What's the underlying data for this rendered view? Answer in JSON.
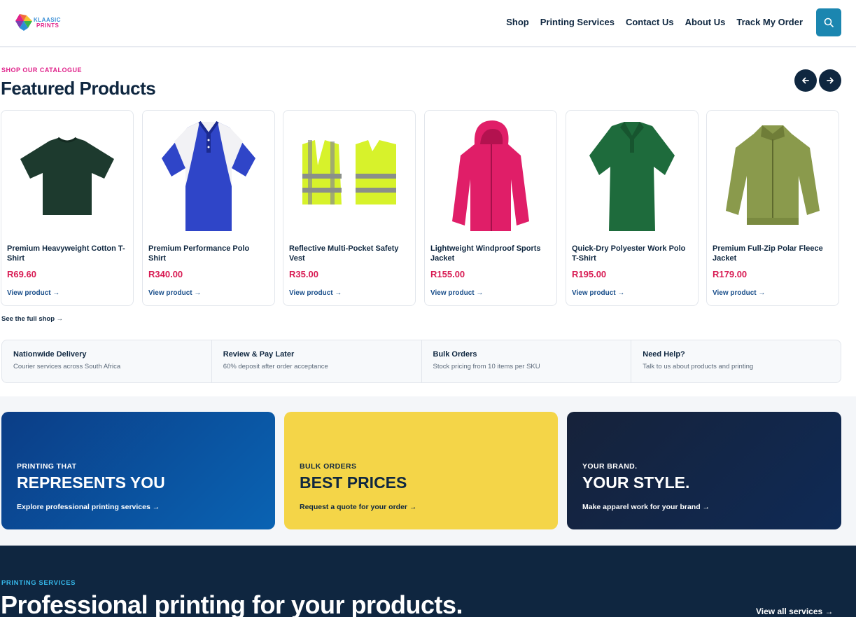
{
  "header": {
    "logo_line1": "KLAASIC",
    "logo_line2": "PRINTS",
    "nav": [
      "Shop",
      "Printing Services",
      "Contact Us",
      "About Us",
      "Track My Order"
    ]
  },
  "catalogue": {
    "eyebrow": "SHOP OUR CATALOGUE",
    "title": "Featured Products",
    "products": [
      {
        "name": "Premium Heavyweight Cotton T-Shirt",
        "price": "R69.60",
        "link": "View product →",
        "image": "tshirt-dark-green"
      },
      {
        "name": "Premium Performance Polo Shirt",
        "price": "R340.00",
        "link": "View product →",
        "image": "polo-blue-white"
      },
      {
        "name": "Reflective Multi-Pocket Safety Vest",
        "price": "R35.00",
        "link": "View product →",
        "image": "safety-vest-yellow"
      },
      {
        "name": "Lightweight Windproof Sports Jacket",
        "price": "R155.00",
        "link": "View product →",
        "image": "jacket-pink"
      },
      {
        "name": "Quick-Dry Polyester Work Polo T-Shirt",
        "price": "R195.00",
        "link": "View product →",
        "image": "polo-green"
      },
      {
        "name": "Premium Full-Zip Polar Fleece Jacket",
        "price": "R179.00",
        "link": "View product →",
        "image": "fleece-olive"
      }
    ],
    "full_shop": "See the full shop →"
  },
  "features": [
    {
      "title": "Nationwide Delivery",
      "sub": "Courier services across South Africa"
    },
    {
      "title": "Review & Pay Later",
      "sub": "60% deposit after order acceptance"
    },
    {
      "title": "Bulk Orders",
      "sub": "Stock pricing from 10 items per SKU"
    },
    {
      "title": "Need Help?",
      "sub": "Talk to us about products and printing"
    }
  ],
  "promos": [
    {
      "eyebrow": "PRINTING THAT",
      "title": "REPRESENTS YOU",
      "link": "Explore professional printing services →"
    },
    {
      "eyebrow": "BULK ORDERS",
      "title": "BEST PRICES",
      "link": "Request a quote for your order →"
    },
    {
      "eyebrow": "YOUR BRAND.",
      "title": "YOUR STYLE.",
      "link": "Make apparel work for your brand →"
    }
  ],
  "services": {
    "eyebrow": "PRINTING SERVICES",
    "title": "Professional printing for your products.",
    "link": "View all services →"
  },
  "colors": {
    "navy": "#0f2740",
    "pink_accent": "#e0218a",
    "price_red": "#d81b53",
    "search_teal": "#1b86b0",
    "promo_yellow": "#f4d548",
    "services_bg": "#0f2640"
  }
}
